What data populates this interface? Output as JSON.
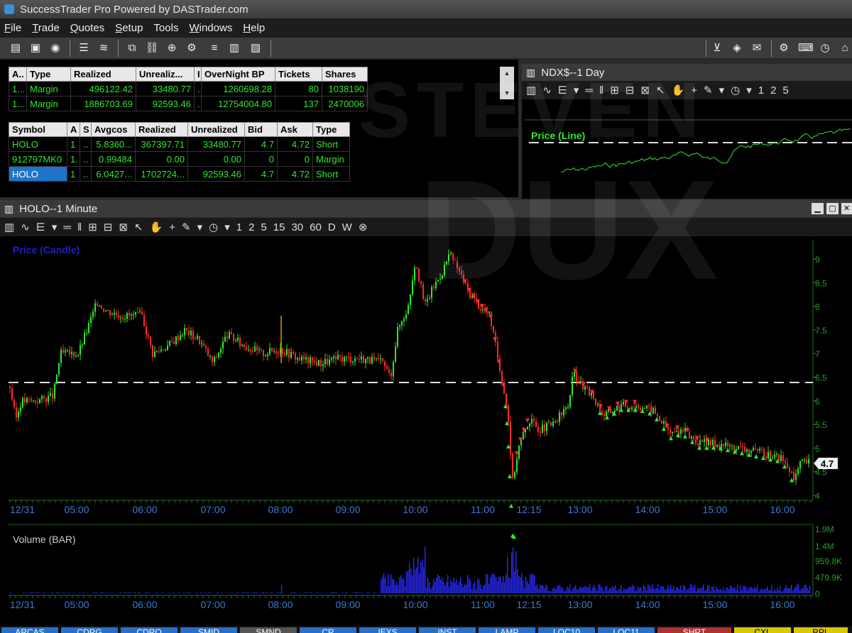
{
  "window": {
    "title": "SuccessTrader Pro Powered by DASTrader.com"
  },
  "menu": [
    {
      "label": "File",
      "u": "F",
      "rest": "ile"
    },
    {
      "label": "Trade",
      "u": "T",
      "rest": "rade"
    },
    {
      "label": "Quotes",
      "u": "Q",
      "rest": "uotes"
    },
    {
      "label": "Setup",
      "u": "S",
      "rest": "etup"
    },
    {
      "label": "Tools",
      "u": "",
      "rest": "Tools"
    },
    {
      "label": "Windows",
      "u": "W",
      "rest": "indows"
    },
    {
      "label": "Help",
      "u": "H",
      "rest": "elp"
    }
  ],
  "account_table": {
    "headers": [
      "A..",
      "Type",
      "Realized",
      "Unrealiz...",
      "I",
      "OverNight BP",
      "Tickets",
      "Shares"
    ],
    "rows": [
      [
        "1...",
        "Margin",
        "496122.42",
        "33480.77",
        ".",
        "1260698.28",
        "80",
        "1038190"
      ],
      [
        "1...",
        "Margin",
        "1886703.69",
        "92593.46",
        ".",
        "12754004.80",
        "137",
        "2470006"
      ]
    ]
  },
  "position_table": {
    "headers": [
      "Symbol",
      "A",
      "S",
      "Avgcos",
      "Realized",
      "Unrealized",
      "Bid",
      "Ask",
      "Type"
    ],
    "rows": [
      [
        "HOLO",
        "1",
        "..",
        "5.8360...",
        "367397.71",
        "33480.77",
        "4.7",
        "4.72",
        "Short"
      ],
      [
        "912797MK0",
        "1.",
        "..",
        "0.99484",
        "0.00",
        "0.00",
        "0",
        "0",
        "Margin"
      ],
      [
        "HOLO",
        "1",
        "..",
        "6.0427...",
        "1702724...",
        "92593.46",
        "4.7",
        "4.72",
        "Short"
      ]
    ]
  },
  "ndx_chart": {
    "title": "NDX$--1 Day",
    "label": "Price (Line)",
    "line_color": "#2ee82e"
  },
  "holo_chart": {
    "title": "HOLO--1 Minute",
    "price_label": "Price (Candle)",
    "volume_label": "Volume (BAR)",
    "last_price": "4.7",
    "date_label": "12/31",
    "price_ticks": [
      "9",
      "8.5",
      "8",
      "7.5",
      "7",
      "6.5",
      "6",
      "5.5",
      "5",
      "4.5",
      "4"
    ],
    "volume_ticks": [
      "1.9M",
      "1.4M",
      "959.8K",
      "479.9K",
      "0"
    ],
    "time_ticks": [
      "05:00",
      "06:00",
      "07:00",
      "08:00",
      "09:00",
      "10:00",
      "11:00",
      "12:15",
      "13:00",
      "14:00",
      "15:00",
      "16:00"
    ],
    "up_color": "#2ee82e",
    "down_color": "#ff2a2a",
    "volume_color": "#2a2aff"
  },
  "chart_toolbar": {
    "intervals": [
      "1",
      "2",
      "5",
      "15",
      "30",
      "60",
      "D",
      "W"
    ]
  },
  "routes": [
    "ARCAS",
    "CDRG",
    "CDRO",
    "SMID",
    "SMND",
    "CR",
    "IEXS",
    "INST",
    "LAMP",
    "LOC10",
    "LOC11",
    "SHRT",
    "CXL",
    "RPL"
  ],
  "watermark": {
    "line1": "STEVEN",
    "line2": "DUX"
  }
}
